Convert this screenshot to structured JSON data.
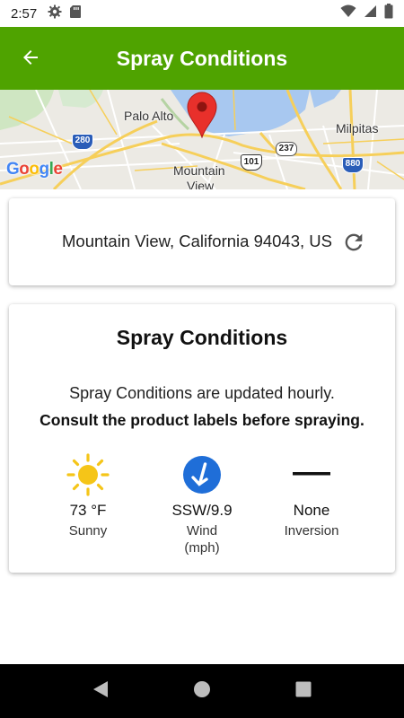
{
  "status_bar": {
    "time": "2:57",
    "left_icons": [
      "gear-icon",
      "sd-card-icon"
    ],
    "right_icons": [
      "wifi-icon",
      "cellular-signal-icon",
      "battery-icon"
    ]
  },
  "app_bar": {
    "title": "Spray Conditions",
    "back_icon": "arrow-left-icon",
    "color": "#4fa300"
  },
  "map": {
    "labels": {
      "palo_alto": "Palo Alto",
      "milpitas": "Milpitas",
      "mountain_view_1": "Mountain",
      "mountain_view_2": "View",
      "hw_280": "280",
      "hw_237": "237",
      "hw_101": "101",
      "hw_880": "880"
    },
    "logo": "Google",
    "pin_color": "#e8302b",
    "water_color": "#a8c8f0"
  },
  "location": {
    "address": "Mountain View, California 94043, US",
    "refresh_icon": "refresh-icon"
  },
  "conditions": {
    "title": "Spray Conditions",
    "subtitle": "Spray Conditions are updated hourly.",
    "warning": "Consult the product labels before spraying.",
    "temperature": {
      "value": "73 °F",
      "label": "Sunny",
      "icon": "sun-icon",
      "color": "#f5c518"
    },
    "wind": {
      "value": "SSW/9.9",
      "label_line1": "Wind",
      "label_line2": "(mph)",
      "icon": "wind-direction-icon",
      "color": "#1f6ed8"
    },
    "inversion": {
      "value": "None",
      "label": "Inversion",
      "icon": "dash-icon"
    }
  },
  "nav_bar": {
    "buttons": [
      "back-triangle-icon",
      "home-circle-icon",
      "recents-square-icon"
    ]
  }
}
